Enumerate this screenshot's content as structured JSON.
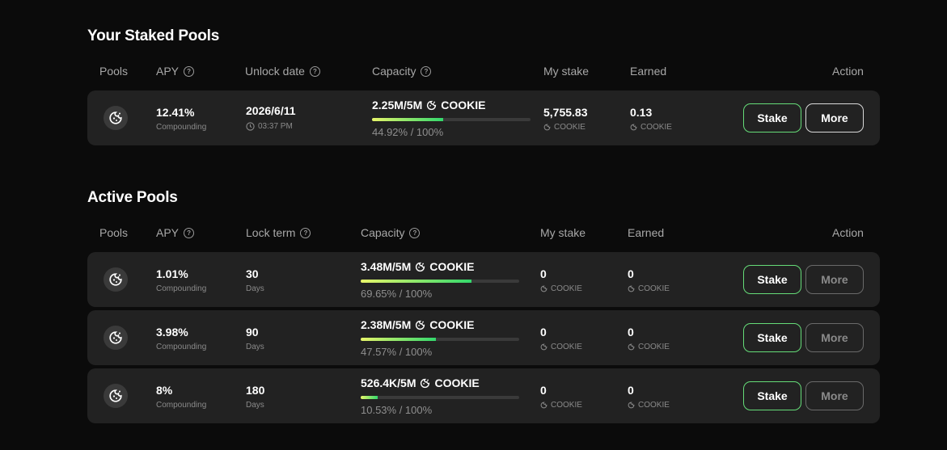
{
  "staked": {
    "title": "Your Staked Pools",
    "headers": {
      "pools": "Pools",
      "apy": "APY",
      "unlock": "Unlock date",
      "capacity": "Capacity",
      "my_stake": "My stake",
      "earned": "Earned",
      "action": "Action"
    },
    "row": {
      "apy": "12.41%",
      "apy_sub": "Compounding",
      "date": "2026/6/11",
      "time": "03:37 PM",
      "capacity": "2.25M/5M",
      "token": "COOKIE",
      "progress": 44.92,
      "progress_text": "44.92% / 100%",
      "my_stake": "5,755.83",
      "my_stake_unit": "COOKIE",
      "earned": "0.13",
      "earned_unit": "COOKIE",
      "stake_label": "Stake",
      "more_label": "More"
    }
  },
  "active": {
    "title": "Active Pools",
    "headers": {
      "pools": "Pools",
      "apy": "APY",
      "lock": "Lock term",
      "capacity": "Capacity",
      "my_stake": "My stake",
      "earned": "Earned",
      "action": "Action"
    },
    "rows": [
      {
        "apy": "1.01%",
        "apy_sub": "Compounding",
        "term": "30",
        "term_unit": "Days",
        "capacity": "3.48M/5M",
        "token": "COOKIE",
        "progress": 69.65,
        "progress_text": "69.65% / 100%",
        "my_stake": "0",
        "my_stake_unit": "COOKIE",
        "earned": "0",
        "earned_unit": "COOKIE",
        "stake_label": "Stake",
        "more_label": "More"
      },
      {
        "apy": "3.98%",
        "apy_sub": "Compounding",
        "term": "90",
        "term_unit": "Days",
        "capacity": "2.38M/5M",
        "token": "COOKIE",
        "progress": 47.57,
        "progress_text": "47.57% / 100%",
        "my_stake": "0",
        "my_stake_unit": "COOKIE",
        "earned": "0",
        "earned_unit": "COOKIE",
        "stake_label": "Stake",
        "more_label": "More"
      },
      {
        "apy": "8%",
        "apy_sub": "Compounding",
        "term": "180",
        "term_unit": "Days",
        "capacity": "526.4K/5M",
        "token": "COOKIE",
        "progress": 10.53,
        "progress_text": "10.53% / 100%",
        "my_stake": "0",
        "my_stake_unit": "COOKIE",
        "earned": "0",
        "earned_unit": "COOKIE",
        "stake_label": "Stake",
        "more_label": "More"
      }
    ]
  },
  "icons": {
    "pool": "cookie-icon",
    "help": "help-circle-icon",
    "clock": "clock-icon"
  },
  "colors": {
    "background": "#0b0b0b",
    "row": "#222222",
    "accent_green": "#33d86c",
    "accent_yellow": "#e7f56a"
  }
}
